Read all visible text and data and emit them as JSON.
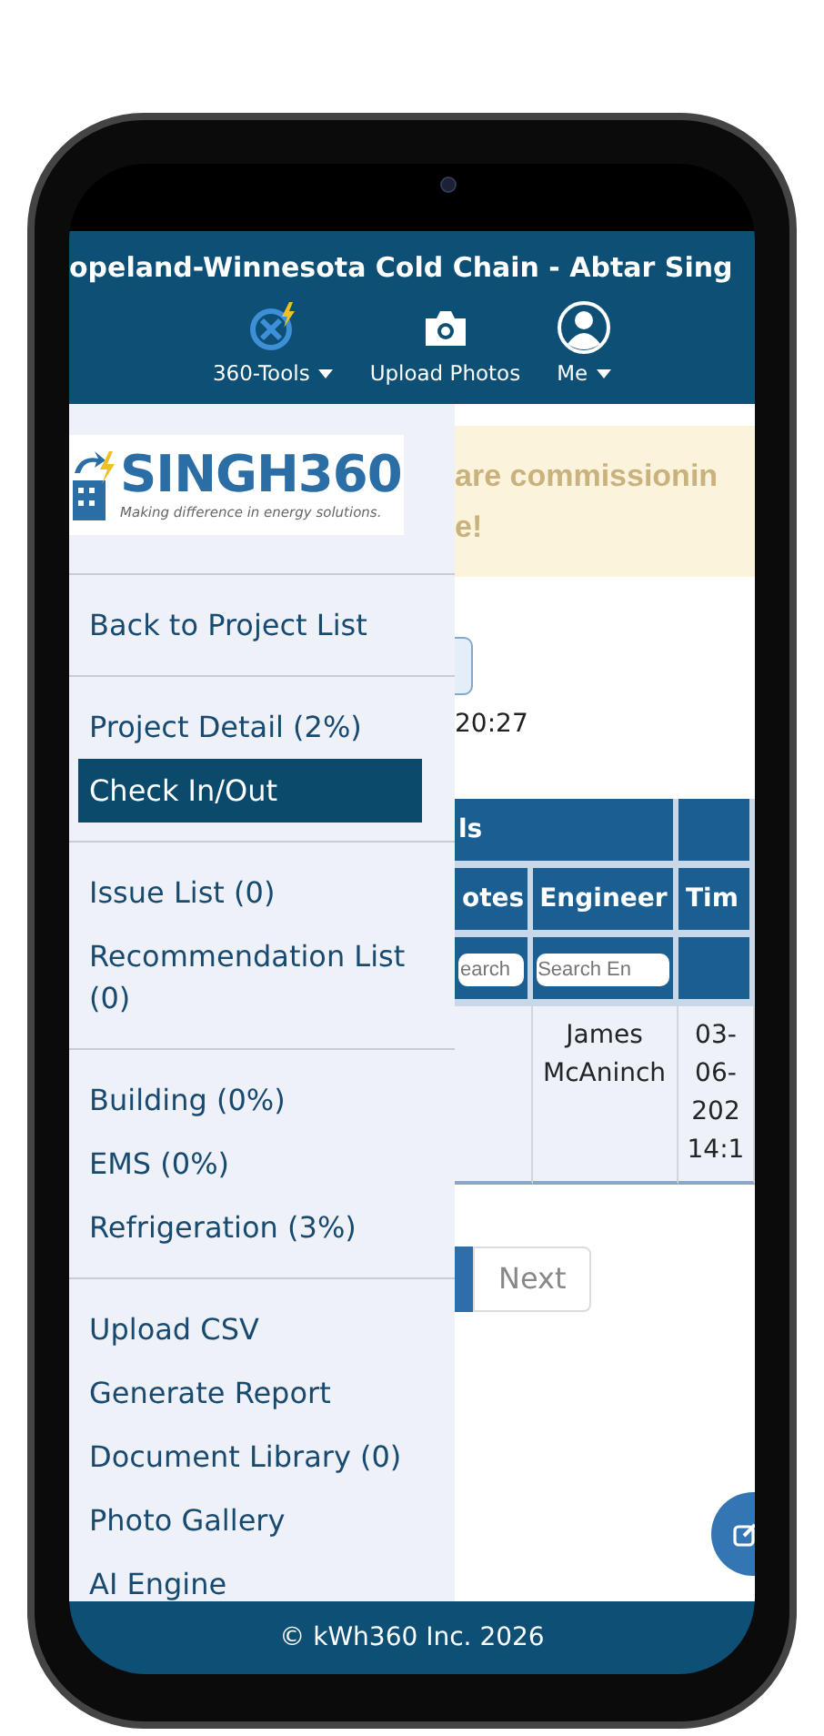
{
  "header": {
    "title": "opeland-Winnesota Cold Chain - Abtar Sing",
    "nav": [
      {
        "label": "360-Tools",
        "dropdown": true
      },
      {
        "label": "Upload Photos",
        "dropdown": false
      },
      {
        "label": "Me",
        "dropdown": true
      }
    ]
  },
  "sidebar": {
    "logo": {
      "name": "SINGH360",
      "tagline": "Making difference in energy solutions."
    },
    "groups": [
      {
        "items": [
          {
            "label": "Back to Project List",
            "selected": false
          }
        ]
      },
      {
        "items": [
          {
            "label": "Project Detail (2%)",
            "selected": false
          },
          {
            "label": "Check In/Out",
            "selected": true
          }
        ]
      },
      {
        "items": [
          {
            "label": "Issue List (0)",
            "selected": false
          },
          {
            "label": "Recommendation List (0)",
            "selected": false
          }
        ]
      },
      {
        "items": [
          {
            "label": "Building (0%)",
            "selected": false
          },
          {
            "label": "EMS (0%)",
            "selected": false
          },
          {
            "label": "Refrigeration (3%)",
            "selected": false
          }
        ]
      },
      {
        "items": [
          {
            "label": "Upload CSV",
            "selected": false
          },
          {
            "label": "Generate Report",
            "selected": false
          },
          {
            "label": "Document Library (0)",
            "selected": false
          },
          {
            "label": "Photo Gallery",
            "selected": false
          },
          {
            "label": "AI Engine",
            "selected": false
          }
        ]
      }
    ]
  },
  "main": {
    "alert_lines": [
      "are commissionin",
      "e!"
    ],
    "time": "20:27",
    "table": {
      "group_header": "ls",
      "columns": [
        "otes",
        "Engineer",
        "Tim"
      ],
      "filters": [
        {
          "placeholder": "earch"
        },
        {
          "placeholder": "Search En"
        }
      ],
      "rows": [
        {
          "engineer": "James McAninch",
          "column_3": [
            "03-",
            "06-",
            "202",
            "14:1"
          ]
        }
      ]
    },
    "pagination": {
      "next": "Next"
    }
  },
  "footer": "© kWh360 Inc. 2026"
}
